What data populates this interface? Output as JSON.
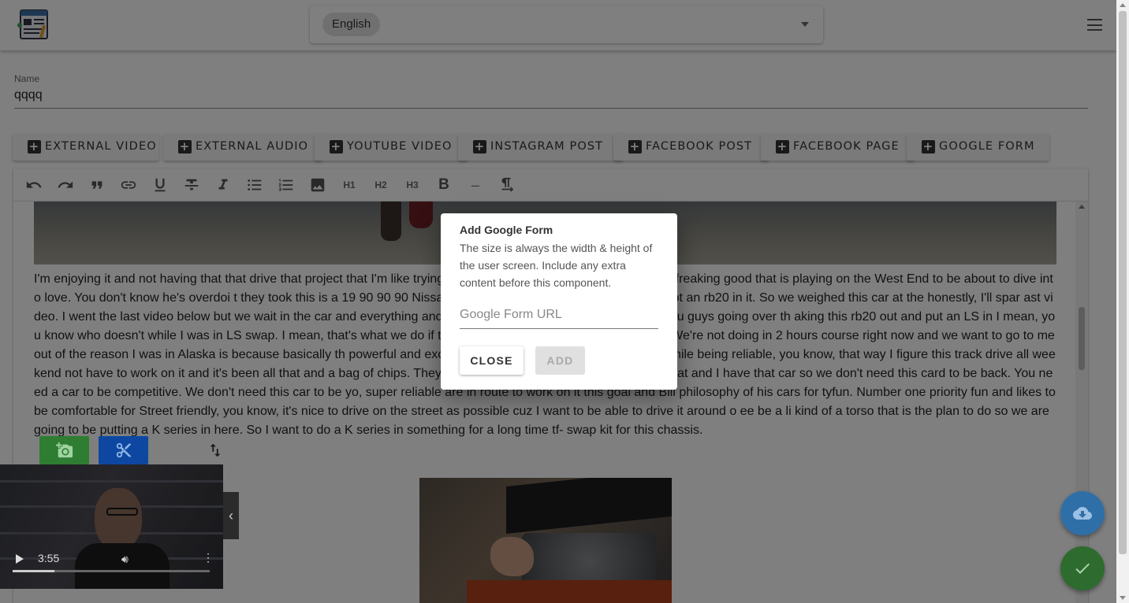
{
  "header": {
    "language": "English"
  },
  "name_field": {
    "label": "Name",
    "value": "qqqq"
  },
  "insert_buttons": [
    {
      "label": "EXTERNAL VIDEO"
    },
    {
      "label": "EXTERNAL AUDIO"
    },
    {
      "label": "YOUTUBE VIDEO"
    },
    {
      "label": "INSTAGRAM POST"
    },
    {
      "label": "FACEBOOK POST"
    },
    {
      "label": "FACEBOOK PAGE"
    },
    {
      "label": "GOOGLE FORM"
    }
  ],
  "toolbar": {
    "h1": "H1",
    "h2": "H2",
    "h3": "H3",
    "bold": "B",
    "hr": "–"
  },
  "editor": {
    "body_text": "I'm enjoying it and not having that that drive that project that I'm like trying to  feelings inside. So Moral Stories feels freaking good that is playing on the West End to be about to dive into love. You don't know he's overdoi  t they took this is a 19 90 90 90 Nissan cefiro a31 chassis suspension but it's got an rb20 in it. So we weighed this car at the honestly, I'll spar  ast video. I went the last video below but we wait in the car and everything and talk more about that stuff. Don't bother you guys going over th  aking this rb20 out and put an LS in I mean, you know who doesn't while I was in LS swap. I mean, that's what we do if that's what we're going. I  d out this video. We're not doing in 2 hours course right now and we want to go to me out of the reason I was in Alaska is because basically th  powerful and exciting and entertaining and whatever but while being reliable, you know, that way I figure this track drive all weekend not have to work on it and it's been all that and a bag of chips. They say it's been a really really good car for that and I have that car so we don't need this card to be back. You need a car to be competitive. We don't need this car to be yo, super reliable are in route to work on it this goal and Bill philosophy of his cars for tyfun. Number one priority fun and likes to be comfortable for Street friendly, you know, it's nice to drive on the street as possible cuz I want to be able to drive it around o  ee  be a li  kind of a torso that is the plan to do so we are going to be putting a K series in here. So I want to do a K series in something for a long time tf-  swap kit for this chassis."
  },
  "video": {
    "time": "3:55",
    "progress": 0.21
  },
  "dialog": {
    "title": "Add Google Form",
    "description": "The size is always the width & height of the user screen. Include any extra content before this component.",
    "input_placeholder": "Google Form URL",
    "close_label": "CLOSE",
    "add_label": "ADD"
  },
  "colors": {
    "download_fab": "#2f6fa8",
    "confirm_fab": "#2e6b2f",
    "camera_button": "#2e7d32",
    "cut_button": "#0d47a1"
  }
}
